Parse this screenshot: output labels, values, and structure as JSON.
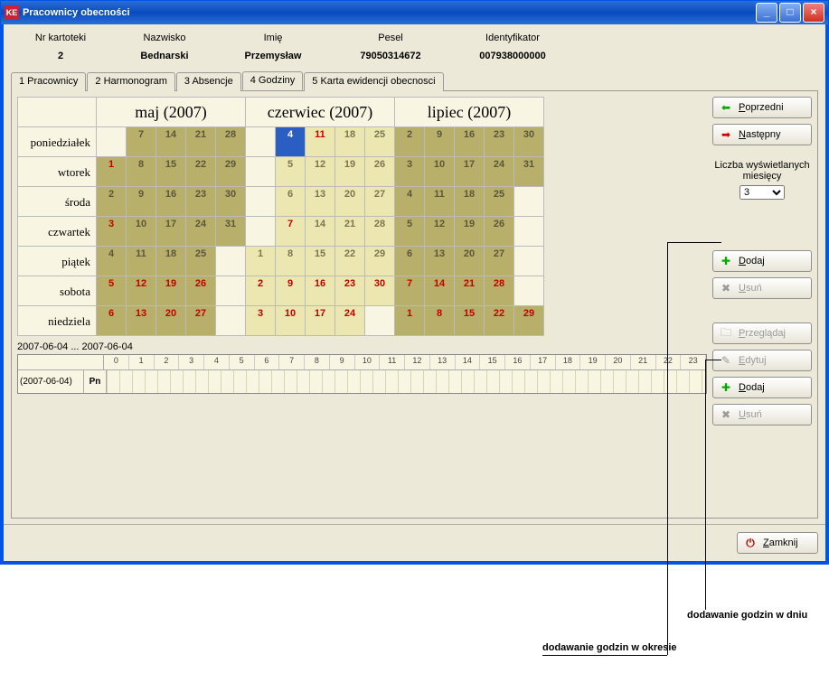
{
  "title": "Pracownicy obecności",
  "info": {
    "headers": [
      "Nr kartoteki",
      "Nazwisko",
      "Imię",
      "Pesel",
      "Identyfikator"
    ],
    "values": [
      "2",
      "Bednarski",
      "Przemysław",
      "79050314672",
      "007938000000"
    ]
  },
  "tabs": [
    "1 Pracownicy",
    "2 Harmonogram",
    "3 Absencje",
    "4 Godziny",
    "5 Karta ewidencji obecnosci"
  ],
  "active_tab": 3,
  "months": [
    {
      "label": "maj (2007)"
    },
    {
      "label": "czerwiec (2007)"
    },
    {
      "label": "lipiec (2007)"
    }
  ],
  "day_names": [
    "poniedziałek",
    "wtorek",
    "środa",
    "czwartek",
    "piątek",
    "sobota",
    "niedziela"
  ],
  "cal": {
    "may": [
      [
        "",
        "7",
        "14",
        "21",
        "28"
      ],
      [
        "1",
        "8",
        "15",
        "22",
        "29"
      ],
      [
        "2",
        "9",
        "16",
        "23",
        "30"
      ],
      [
        "3",
        "10",
        "17",
        "24",
        "31"
      ],
      [
        "4",
        "11",
        "18",
        "25",
        ""
      ],
      [
        "5",
        "12",
        "19",
        "26",
        ""
      ],
      [
        "6",
        "13",
        "20",
        "27",
        ""
      ]
    ],
    "jun": [
      [
        "",
        "4",
        "11",
        "18",
        "25"
      ],
      [
        "",
        "5",
        "12",
        "19",
        "26"
      ],
      [
        "",
        "6",
        "13",
        "20",
        "27"
      ],
      [
        "",
        "7",
        "14",
        "21",
        "28"
      ],
      [
        "1",
        "8",
        "15",
        "22",
        "29"
      ],
      [
        "2",
        "9",
        "16",
        "23",
        "30"
      ],
      [
        "3",
        "10",
        "17",
        "24",
        ""
      ]
    ],
    "jul": [
      [
        "2",
        "9",
        "16",
        "23",
        "30"
      ],
      [
        "3",
        "10",
        "17",
        "24",
        "31"
      ],
      [
        "4",
        "11",
        "18",
        "25",
        ""
      ],
      [
        "5",
        "12",
        "19",
        "26",
        ""
      ],
      [
        "6",
        "13",
        "20",
        "27",
        ""
      ],
      [
        "7",
        "14",
        "21",
        "28",
        ""
      ],
      [
        "1",
        "8",
        "15",
        "22",
        "29",
        ""
      ]
    ]
  },
  "nav": {
    "prev": "Poprzedni",
    "next": "Następny"
  },
  "months_count_label": "Liczba wyświetlanych miesięcy",
  "months_count_value": "3",
  "buttons": {
    "dodaj": "Dodaj",
    "usun": "Usuń",
    "przegladaj": "Przeglądaj",
    "edytuj": "Edytuj",
    "zamknij": "Zamknij"
  },
  "timeline": {
    "range": "2007-06-04 ... 2007-06-04",
    "date": "(2007-06-04)",
    "day": "Pn",
    "hours": [
      "0",
      "1",
      "2",
      "3",
      "4",
      "5",
      "6",
      "7",
      "8",
      "9",
      "10",
      "11",
      "12",
      "13",
      "14",
      "15",
      "16",
      "17",
      "18",
      "19",
      "20",
      "21",
      "22",
      "23"
    ]
  },
  "annotations": {
    "a1": "dodawanie godzin w dniu",
    "a2": "dodawanie godzin w okresie"
  }
}
